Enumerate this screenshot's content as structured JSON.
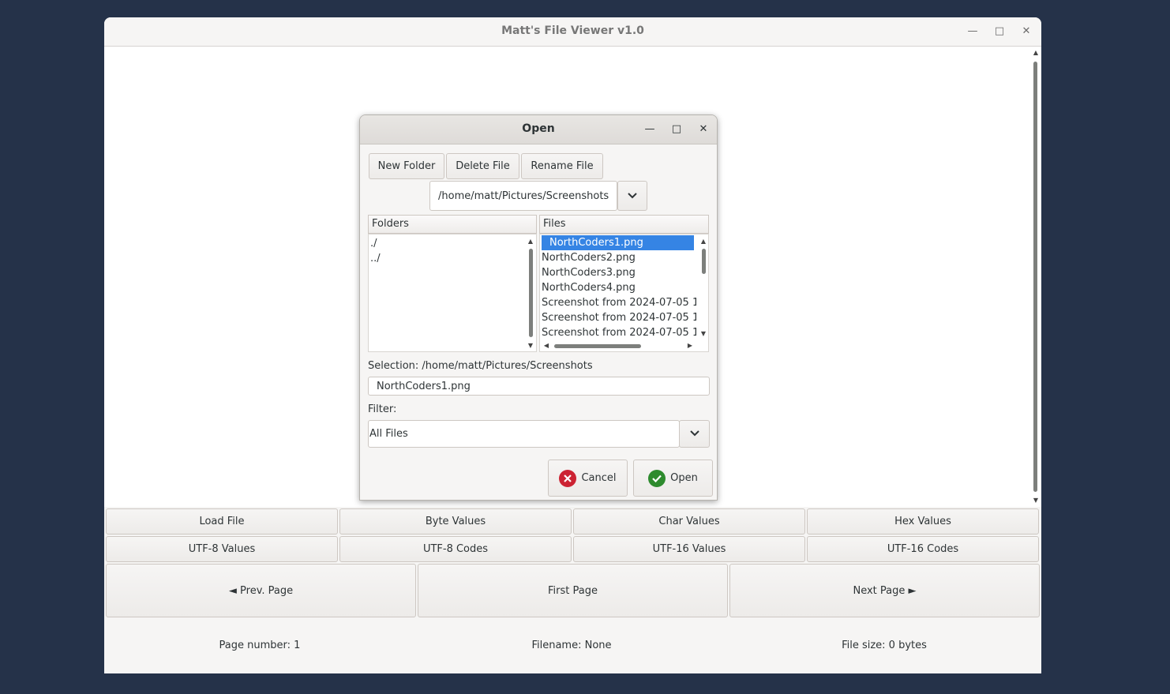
{
  "main_window": {
    "title": "Matt's File Viewer v1.0",
    "buttons_row1": [
      "Load File",
      "Byte Values",
      "Char Values",
      "Hex Values"
    ],
    "buttons_row2": [
      "UTF-8 Values",
      "UTF-8 Codes",
      "UTF-16 Values",
      "UTF-16 Codes"
    ],
    "nav": {
      "prev": "◄  Prev. Page",
      "first": "First Page",
      "next": "Next Page  ►"
    },
    "status": {
      "page_number": "Page number: 1",
      "filename": "Filename: None",
      "file_size": "File size: 0 bytes"
    }
  },
  "dialog": {
    "title": "Open",
    "toolbar": {
      "new_folder": "New Folder",
      "delete_file": "Delete File",
      "rename_file": "Rename File"
    },
    "path": "/home/matt/Pictures/Screenshots",
    "folders_header": "Folders",
    "files_header": "Files",
    "folders": [
      "./",
      "../"
    ],
    "files": [
      "NorthCoders1.png",
      "NorthCoders2.png",
      "NorthCoders3.png",
      "NorthCoders4.png",
      "Screenshot from 2024-07-05 1",
      "Screenshot from 2024-07-05 1",
      "Screenshot from 2024-07-05 1"
    ],
    "selection_label": "Selection: /home/matt/Pictures/Screenshots",
    "selection_value": "NorthCoders1.png",
    "filter_label": "Filter:",
    "filter_value": "All Files",
    "cancel": "Cancel",
    "open": "Open"
  },
  "icons": {
    "cancel": "red-x-circle",
    "open": "green-check-circle"
  },
  "colors": {
    "desktop": "#253249",
    "selection": "#3584e4",
    "cancel_icon": "#cc2333",
    "open_icon": "#2e8b2e"
  }
}
